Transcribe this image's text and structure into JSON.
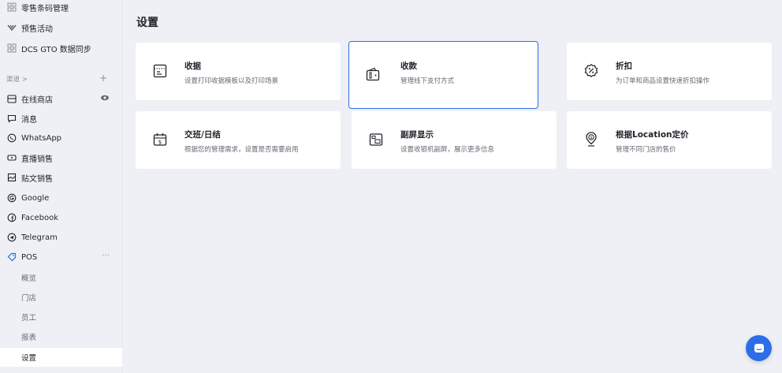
{
  "sidebar": {
    "top_items": [
      {
        "label": "零售条码管理",
        "icon": "barcode-icon"
      },
      {
        "label": "预售活动",
        "icon": "presale-icon"
      },
      {
        "label": "DCS GTO 数据同步",
        "icon": "sync-icon"
      }
    ],
    "channels_label": "渠道 >",
    "channels_add": "+",
    "channels": [
      {
        "label": "在线商店",
        "icon": "store-icon",
        "trail": "eye-icon"
      },
      {
        "label": "消息",
        "icon": "message-icon"
      },
      {
        "label": "WhatsApp",
        "icon": "whatsapp-icon"
      },
      {
        "label": "直播销售",
        "icon": "live-icon"
      },
      {
        "label": "贴文销售",
        "icon": "post-icon"
      },
      {
        "label": "Google",
        "icon": "google-icon"
      },
      {
        "label": "Facebook",
        "icon": "facebook-icon"
      },
      {
        "label": "Telegram",
        "icon": "telegram-icon"
      },
      {
        "label": "POS",
        "icon": "pos-icon",
        "trail": "···"
      }
    ],
    "pos_sub": [
      {
        "label": "概览"
      },
      {
        "label": "门店"
      },
      {
        "label": "员工"
      },
      {
        "label": "报表"
      },
      {
        "label": "设置"
      }
    ]
  },
  "main": {
    "title": "设置",
    "cards": [
      {
        "title": "收据",
        "desc": "设置打印收据模板以及打印场景",
        "icon": "receipt-icon"
      },
      {
        "title": "收款",
        "desc": "管理线下支付方式",
        "icon": "wallet-icon"
      },
      {
        "title": "折扣",
        "desc": "为订单和商品设置快速折扣操作",
        "icon": "discount-icon"
      },
      {
        "title": "交班/日结",
        "desc": "根据您的管理需求，设置是否需要启用",
        "icon": "calendar-cash-icon"
      },
      {
        "title": "副屏显示",
        "desc": "设置收银机副屏，展示更多信息",
        "icon": "second-screen-icon"
      },
      {
        "title": "根据Location定价",
        "desc": "管理不同门店的售价",
        "icon": "location-price-icon"
      }
    ]
  },
  "colors": {
    "accent": "#2b6ee8",
    "background": "#eef0f5",
    "card": "#ffffff"
  },
  "chat": {
    "icon": "chat-icon"
  }
}
